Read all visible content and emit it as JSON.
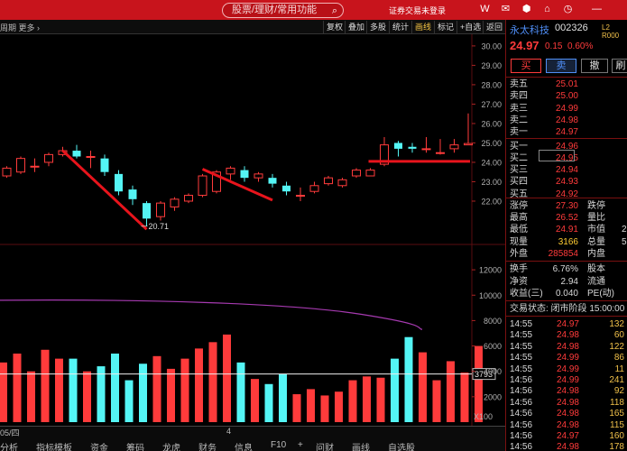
{
  "titlebar": {
    "search_placeholder": "股票/理财/常用功能",
    "status": "证券交易未登录",
    "icons": [
      "W",
      "✉",
      "⬢",
      "👕",
      "⏱",
      "—"
    ]
  },
  "toolbar": {
    "cycle": "周期 更多 ›",
    "buttons": [
      {
        "label": "复权",
        "active": false
      },
      {
        "label": "叠加",
        "active": false
      },
      {
        "label": "多股",
        "active": false
      },
      {
        "label": "统计",
        "active": false
      },
      {
        "label": "画线",
        "active": true
      },
      {
        "label": "标记",
        "active": false
      },
      {
        "label": "+自选",
        "active": false
      },
      {
        "label": "返回",
        "active": false
      }
    ]
  },
  "chart_data": {
    "type": "candlestick",
    "price_axis_ticks": [
      "30.00",
      "29.00",
      "28.00",
      "27.00",
      "26.00",
      "25.00",
      "24.00",
      "23.00",
      "22.00"
    ],
    "volume_axis_ticks": [
      "12000",
      "10000",
      "8000",
      "6000",
      "4000",
      "2000"
    ],
    "volume_unit": "X100",
    "price_ylim": [
      20.0,
      30.6
    ],
    "volume_ylim": [
      0,
      13500
    ],
    "low_label": "20.71",
    "volume_marker": "3793",
    "candles": [
      {
        "o": 23.3,
        "c": 23.7,
        "h": 23.8,
        "l": 23.2
      },
      {
        "o": 23.5,
        "c": 24.2,
        "h": 24.3,
        "l": 23.4
      },
      {
        "o": 23.8,
        "c": 23.8,
        "h": 24.2,
        "l": 23.5
      },
      {
        "o": 24.0,
        "c": 24.4,
        "h": 24.5,
        "l": 23.8
      },
      {
        "o": 24.4,
        "c": 24.6,
        "h": 24.8,
        "l": 24.3
      },
      {
        "o": 24.6,
        "c": 24.3,
        "h": 24.9,
        "l": 24.2
      },
      {
        "o": 24.3,
        "c": 24.3,
        "h": 24.6,
        "l": 23.7
      },
      {
        "o": 24.2,
        "c": 23.5,
        "h": 24.4,
        "l": 23.3
      },
      {
        "o": 23.4,
        "c": 22.5,
        "h": 23.6,
        "l": 22.3
      },
      {
        "o": 22.6,
        "c": 22.1,
        "h": 22.8,
        "l": 21.8
      },
      {
        "o": 21.9,
        "c": 21.1,
        "h": 22.0,
        "l": 20.71
      },
      {
        "o": 21.2,
        "c": 21.9,
        "h": 22.0,
        "l": 21.0
      },
      {
        "o": 21.7,
        "c": 22.1,
        "h": 22.2,
        "l": 21.5
      },
      {
        "o": 22.0,
        "c": 22.3,
        "h": 22.4,
        "l": 21.9
      },
      {
        "o": 22.3,
        "c": 23.3,
        "h": 23.4,
        "l": 22.2
      },
      {
        "o": 22.5,
        "c": 23.5,
        "h": 23.6,
        "l": 22.4
      },
      {
        "o": 23.4,
        "c": 23.7,
        "h": 23.8,
        "l": 23.1
      },
      {
        "o": 23.6,
        "c": 23.2,
        "h": 23.8,
        "l": 23.0
      },
      {
        "o": 23.2,
        "c": 23.4,
        "h": 23.5,
        "l": 23.0
      },
      {
        "o": 23.2,
        "c": 22.9,
        "h": 23.4,
        "l": 22.7
      },
      {
        "o": 22.8,
        "c": 22.5,
        "h": 23.0,
        "l": 22.3
      },
      {
        "o": 22.3,
        "c": 22.3,
        "h": 22.7,
        "l": 22.0
      },
      {
        "o": 22.5,
        "c": 22.8,
        "h": 23.0,
        "l": 22.4
      },
      {
        "o": 22.9,
        "c": 23.2,
        "h": 23.3,
        "l": 22.8
      },
      {
        "o": 22.8,
        "c": 23.1,
        "h": 23.2,
        "l": 22.7
      },
      {
        "o": 23.3,
        "c": 23.6,
        "h": 23.7,
        "l": 23.2
      },
      {
        "o": 23.3,
        "c": 23.6,
        "h": 23.7,
        "l": 23.3
      },
      {
        "o": 23.9,
        "c": 24.9,
        "h": 25.3,
        "l": 23.8
      },
      {
        "o": 25.0,
        "c": 24.7,
        "h": 25.1,
        "l": 24.3
      },
      {
        "o": 24.8,
        "c": 24.7,
        "h": 25.0,
        "l": 24.5
      },
      {
        "o": 24.7,
        "c": 24.7,
        "h": 25.3,
        "l": 24.5
      },
      {
        "o": 24.5,
        "c": 24.5,
        "h": 25.2,
        "l": 24.4
      },
      {
        "o": 24.7,
        "c": 24.9,
        "h": 25.2,
        "l": 24.5
      },
      {
        "o": 24.9,
        "c": 24.97,
        "h": 26.52,
        "l": 24.91
      }
    ],
    "volumes": [
      4700,
      5400,
      4000,
      5700,
      5000,
      5000,
      4000,
      4400,
      5400,
      3300,
      4600,
      5200,
      4200,
      5000,
      5800,
      6300,
      6900,
      4700,
      3400,
      3000,
      3800,
      2200,
      2600,
      2100,
      2400,
      3300,
      3600,
      3500,
      5000,
      6700,
      5500,
      3300,
      4800,
      3900,
      6000
    ]
  },
  "panel": {
    "name": "永太科技",
    "code": "002326",
    "level": "L2 R000",
    "price": "24.97",
    "change": "0.15",
    "pct": "0.60%",
    "trade_buttons": [
      "买",
      "卖",
      "撤",
      "刷"
    ],
    "sell_levels": [
      {
        "label": "卖五",
        "price": "25.01",
        "vol": ""
      },
      {
        "label": "卖四",
        "price": "25.00",
        "vol": ""
      },
      {
        "label": "卖三",
        "price": "24.99",
        "vol": ""
      },
      {
        "label": "卖二",
        "price": "24.98",
        "vol": ""
      },
      {
        "label": "卖一",
        "price": "24.97",
        "vol": ""
      }
    ],
    "buy_levels": [
      {
        "label": "买一",
        "price": "24.96",
        "vol": ""
      },
      {
        "label": "买二",
        "price": "24.95",
        "vol": ""
      },
      {
        "label": "买三",
        "price": "24.94",
        "vol": ""
      },
      {
        "label": "买四",
        "price": "24.93",
        "vol": ""
      },
      {
        "label": "买五",
        "price": "24.92",
        "vol": ""
      }
    ],
    "stats": [
      {
        "label": "涨停",
        "value": "27.30",
        "label2": "跌停"
      },
      {
        "label": "最高",
        "value": "26.52",
        "label2": "量比"
      },
      {
        "label": "最低",
        "value": "24.91",
        "label2": "市值"
      },
      {
        "label": "现量",
        "value": "3166",
        "label2": "总量"
      },
      {
        "label": "外盘",
        "value": "285854",
        "label2": "内盘"
      }
    ],
    "stats_tail": [
      "",
      "",
      "2",
      "5",
      ""
    ],
    "stats2": [
      {
        "label": "换手",
        "value": "6.76%",
        "label2": "股本"
      },
      {
        "label": "净资",
        "value": "2.94",
        "label2": "流通"
      },
      {
        "label": "收益(三)",
        "value": "0.040",
        "label2": "PE(动)"
      }
    ],
    "trade_status_label": "交易状态: 闭市阶段 15:00:00",
    "ticks": [
      {
        "t": "14:55",
        "p": "24.97",
        "v": "132",
        "c": "#f0c04a"
      },
      {
        "t": "14:55",
        "p": "24.98",
        "v": "60",
        "c": "#f0c04a"
      },
      {
        "t": "14:55",
        "p": "24.98",
        "v": "122",
        "c": "#f0c04a"
      },
      {
        "t": "14:55",
        "p": "24.99",
        "v": "86",
        "c": "#f0c04a"
      },
      {
        "t": "14:55",
        "p": "24.99",
        "v": "11",
        "c": "#f0c04a"
      },
      {
        "t": "14:56",
        "p": "24.99",
        "v": "241",
        "c": "#f0c04a"
      },
      {
        "t": "14:56",
        "p": "24.98",
        "v": "92",
        "c": "#f0c04a"
      },
      {
        "t": "14:56",
        "p": "24.98",
        "v": "118",
        "c": "#f0c04a"
      },
      {
        "t": "14:56",
        "p": "24.98",
        "v": "165",
        "c": "#f0c04a"
      },
      {
        "t": "14:56",
        "p": "24.98",
        "v": "115",
        "c": "#f0c04a"
      },
      {
        "t": "14:56",
        "p": "24.97",
        "v": "160",
        "c": "#f0c04a"
      },
      {
        "t": "14:56",
        "p": "24.98",
        "v": "178",
        "c": "#f0c04a"
      }
    ]
  },
  "bottom": {
    "dates": [
      "05/四",
      "4"
    ],
    "tabs": [
      "分析",
      "指标模板",
      "资金",
      "筹码",
      "龙虎",
      "财务",
      "信息",
      "F10",
      "+",
      "问财",
      "画线",
      "自选股"
    ]
  },
  "colors": {
    "up": "#ff3b3b",
    "down": "#54f5f5",
    "line": "#e8141c",
    "ma": "#a63ab0",
    "grid": "#5a0d10"
  }
}
